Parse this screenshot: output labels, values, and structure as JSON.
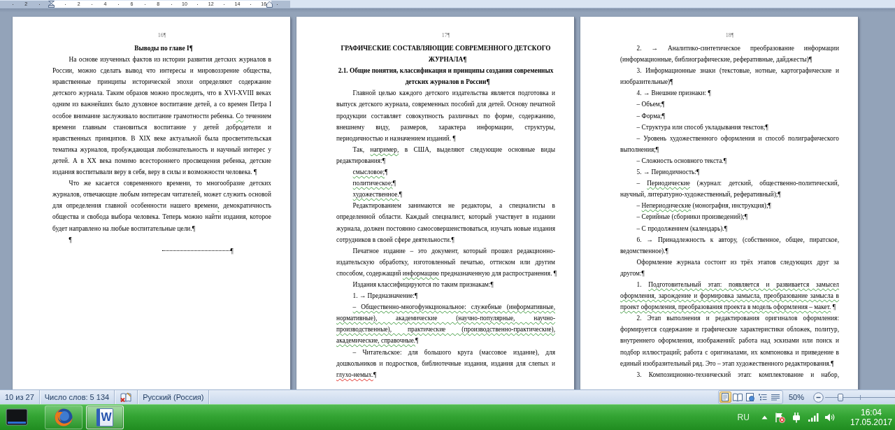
{
  "ruler": {
    "labels": [
      "2",
      "2",
      "4",
      "6",
      "8",
      "10",
      "12",
      "14",
      "16"
    ]
  },
  "pages": [
    {
      "number": "16¶",
      "blocks": [
        {
          "kind": "heading",
          "text": "Выводы по главе I",
          "end_mark": "¶"
        },
        {
          "kind": "paragraph",
          "runs": [
            {
              "text": "На основе изученных фактов из истории развития детских журналов в России, можно сделать вывод что интересы и мировоззрение общества, нравственные принципы исторической эпохи определяют содержание детского журнала. Таким образов можно проследить, что в XVI-XVIII веках одним из важнейших было духовное воспитание детей, а со времен Петра I особое внимание заслуживало воспитание грамотности ребенка. "
            },
            {
              "text": "Со",
              "grammar_error": true
            },
            {
              "text": " течением времени главным становиться воспитание у детей добродетели и нравственных принципов. В XIX веке актуальной была просветительская тематика журналов, пробуждающая любознательность и научный интерес у детей. А в XX века помимо всестороннего просвещения ребенка, детские издания воспитывали веру в себя, веру в силы и возможности человека."
            }
          ],
          "end_mark": " ¶"
        },
        {
          "kind": "paragraph",
          "runs": [
            {
              "text": "Что же касается современного времени, то многообразие детских журналов, отвечающие любым интересам читателей, может служить основой для определения главной особенности нашего времени"
            },
            {
              "text": ",",
              "grammar_error": true
            },
            {
              "text": " демократичность общества и свобода выбора человека. Теперь можно найти издания, которое будет направлено на любые воспитательные цели."
            }
          ],
          "end_mark": "¶"
        },
        {
          "kind": "paragraph",
          "text": "¶"
        },
        {
          "kind": "page_break",
          "text": "¶"
        }
      ]
    },
    {
      "number": "17¶",
      "blocks": [
        {
          "kind": "heading",
          "text": "ГРАФИЧЕСКИЕ СОСТАВЛЯЮЩИЕ СОВРЕМЕННОГО ДЕТСКОГО ЖУРНАЛА",
          "end_mark": "¶"
        },
        {
          "kind": "heading",
          "text": "2.1. Общие понятия, классификация и принципы создания современных детских журналов в России",
          "end_mark": "¶"
        },
        {
          "kind": "paragraph",
          "text": "Главной целью каждого детского издательства является подготовка и выпуск детского журнала, современных пособий для детей. Основу печатной продукции составляет совокупность различных по форме, содержанию, внешнему виду, размеров, характера информации, структуры, периодичностью и назначением изданий.",
          "end_mark": " ¶"
        },
        {
          "kind": "paragraph",
          "runs": [
            {
              "text": "Так, "
            },
            {
              "text": "например,",
              "grammar_error": true
            },
            {
              "text": " в США, выделяют следующие основные виды редактирования:"
            }
          ],
          "end_mark": "¶"
        },
        {
          "kind": "paragraph",
          "runs": [
            {
              "text": "смысловое;",
              "grammar_error": true
            }
          ],
          "end_mark": "¶"
        },
        {
          "kind": "paragraph",
          "runs": [
            {
              "text": "политическое;",
              "grammar_error": true
            }
          ],
          "end_mark": "¶"
        },
        {
          "kind": "paragraph",
          "runs": [
            {
              "text": "художественное.",
              "grammar_error": true
            }
          ],
          "end_mark": "¶"
        },
        {
          "kind": "paragraph",
          "text": "Редактированием занимаются не редакторы, а специалисты в определенной области. Каждый специалист, который участвует в издании журнала, должен постоянно самосовершенствоваться, изучать новые издания сотрудников в своей сфере деятельности.",
          "end_mark": "¶"
        },
        {
          "kind": "paragraph",
          "runs": [
            {
              "text": "Печатное издание – это документ, который прошел редакционно-издательскую обработку, изготовленный печатью, оттиском или другим способом, содержащий "
            },
            {
              "text": "информацию",
              "grammar_error": true
            },
            {
              "text": " предназначенную для распространения."
            }
          ],
          "end_mark": " ¶"
        },
        {
          "kind": "paragraph",
          "text": "Издания классифицируются по таким признакам:",
          "end_mark": "¶"
        },
        {
          "kind": "paragraph",
          "text": "1. → Предназначение:",
          "end_mark": "¶"
        },
        {
          "kind": "paragraph",
          "runs": [
            {
              "text": "– Общественно-многофункциональное: служебные (информативные, нормативные), академические (научно-популярные, научно-производственные), практические (производственно-практические), академические, справочные.",
              "grammar_error": true
            }
          ],
          "end_mark": "¶"
        },
        {
          "kind": "paragraph",
          "runs": [
            {
              "text": "– Читательское: для большого круга (массовое издание), для дошкольников и подростков, библиотечные издания, издания для слепых и "
            },
            {
              "text": "глухо-немых.",
              "spelling_error": true
            }
          ],
          "end_mark": "¶"
        }
      ]
    },
    {
      "number": "18¶",
      "blocks": [
        {
          "kind": "paragraph",
          "text": "2. → Аналитико-синтетическое преобразование информации (информационные, библиографические, реферативные, дайджесты)",
          "end_mark": "¶"
        },
        {
          "kind": "paragraph",
          "text": "3. Информационные знаки (текстовые, нотные, картографические и изобразительные)",
          "end_mark": "¶"
        },
        {
          "kind": "paragraph",
          "text": "4. → Внешние признаки:",
          "end_mark": " ¶"
        },
        {
          "kind": "paragraph",
          "text": "– Объем;",
          "end_mark": "¶"
        },
        {
          "kind": "paragraph",
          "text": "– Форма;",
          "end_mark": "¶"
        },
        {
          "kind": "paragraph",
          "text": "– Структура или способ укладывания текстов;",
          "end_mark": "¶"
        },
        {
          "kind": "paragraph",
          "text": "– Уровень художественного оформления и способ полиграфического выполнения;",
          "end_mark": "¶"
        },
        {
          "kind": "paragraph",
          "text": "– Сложность основного текста.",
          "end_mark": "¶"
        },
        {
          "kind": "paragraph",
          "text": "5. → Периодичность:",
          "end_mark": "¶"
        },
        {
          "kind": "paragraph",
          "runs": [
            {
              "text": "– "
            },
            {
              "text": "Периодические",
              "grammar_error": true
            },
            {
              "text": " (журнал: детский, общественно-политический, научный, литературно-художественный, реферативный);"
            }
          ],
          "end_mark": "¶"
        },
        {
          "kind": "paragraph",
          "runs": [
            {
              "text": "– "
            },
            {
              "text": "Непериодические",
              "grammar_error": true
            },
            {
              "text": " (монография, инструкция);"
            }
          ],
          "end_mark": "¶"
        },
        {
          "kind": "paragraph",
          "text": "– Серийные (сборники произведений);",
          "end_mark": "¶"
        },
        {
          "kind": "paragraph",
          "text": "– С продолжением (календарь).",
          "end_mark": "¶"
        },
        {
          "kind": "paragraph",
          "text": "6. → Принадлежность к автору, (собственное, общее, пиратское, ведомственное).",
          "end_mark": "¶"
        },
        {
          "kind": "paragraph",
          "text": "Оформление журнала состоит из трёх этапов следующих друг за другом:",
          "end_mark": "¶"
        },
        {
          "kind": "paragraph",
          "runs": [
            {
              "text": "1. "
            },
            {
              "text": "Подготовительный этап: появляется и развивается замысел оформления, зарождение и формировка замысла, преобразование замысла в проект оформления, преобразования проекта в модель оформления – макет.",
              "grammar_error": true
            }
          ],
          "end_mark": " ¶"
        },
        {
          "kind": "paragraph",
          "text": "2. Этап выполнения и редактирования оригиналов оформления: формируется содержание и графические характеристики обложек, политур, внутреннего оформления, изображений: работа над эскизами или поиск и подбор иллюстраций; работа с оригиналами, их компоновка и приведение в единый изобразительный ряд. Это – этап художественного редактирования.",
          "end_mark": "¶"
        },
        {
          "kind": "paragraph",
          "text": "3. Композиционно-технический этап: комплектование и набор,",
          "continues": true
        }
      ]
    }
  ],
  "status_bar": {
    "page": "10 из 27",
    "word_count": "Число слов: 5 134",
    "language": "Русский (Россия)",
    "views": [
      {
        "kind": "print_layout",
        "selected": true
      },
      {
        "kind": "reading",
        "selected": false
      },
      {
        "kind": "web",
        "selected": false
      },
      {
        "kind": "outline",
        "selected": false
      },
      {
        "kind": "draft",
        "selected": false
      }
    ],
    "zoom": "50%",
    "zoom_slider": {
      "level": 0.22
    }
  },
  "taskbar": {
    "apps": [
      {
        "kind": "browser",
        "selected": false
      },
      {
        "kind": "word",
        "glyph": "W",
        "selected": true
      }
    ],
    "language": "RU",
    "time": "16:04",
    "date": "17.05.2017"
  }
}
